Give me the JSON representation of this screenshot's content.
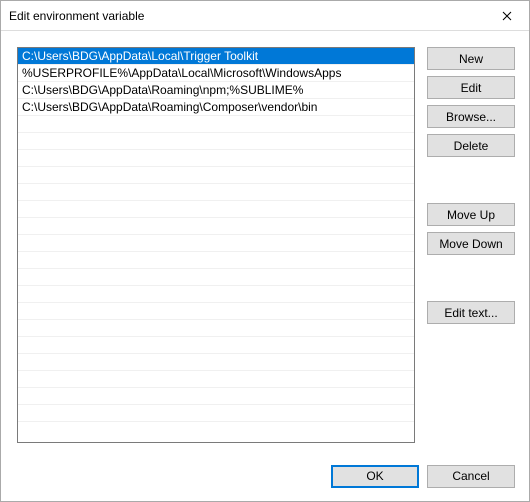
{
  "window": {
    "title": "Edit environment variable"
  },
  "list": {
    "items": [
      {
        "text": "C:\\Users\\BDG\\AppData\\Local\\Trigger Toolkit",
        "selected": true
      },
      {
        "text": "%USERPROFILE%\\AppData\\Local\\Microsoft\\WindowsApps",
        "selected": false
      },
      {
        "text": "C:\\Users\\BDG\\AppData\\Roaming\\npm;%SUBLIME%",
        "selected": false
      },
      {
        "text": "C:\\Users\\BDG\\AppData\\Roaming\\Composer\\vendor\\bin",
        "selected": false
      }
    ],
    "visible_rows": 22
  },
  "buttons": {
    "new": "New",
    "edit": "Edit",
    "browse": "Browse...",
    "delete": "Delete",
    "move_up": "Move Up",
    "move_down": "Move Down",
    "edit_text": "Edit text...",
    "ok": "OK",
    "cancel": "Cancel"
  }
}
